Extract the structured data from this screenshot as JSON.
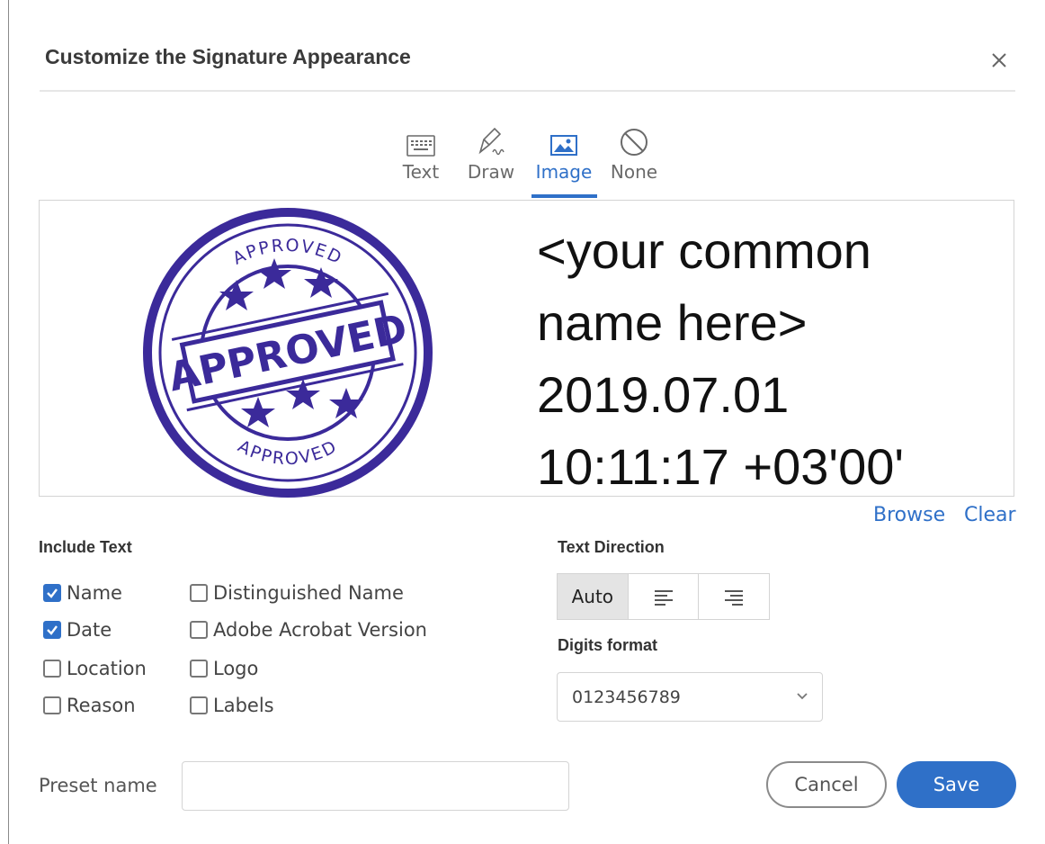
{
  "dialog": {
    "title": "Customize the Signature Appearance",
    "accent_color": "#2f70c8"
  },
  "tabs": [
    {
      "label": "Text",
      "icon": "keyboard-icon",
      "active": false
    },
    {
      "label": "Draw",
      "icon": "pen-icon",
      "active": false
    },
    {
      "label": "Image",
      "icon": "image-icon",
      "active": true
    },
    {
      "label": "None",
      "icon": "no-symbol-icon",
      "active": false
    }
  ],
  "preview": {
    "stamp_word": "APPROVED",
    "stamp_color": "#3b2a9a",
    "signature_lines": [
      "<your common",
      "name here>",
      "2019.07.01",
      "10:11:17 +03'00'"
    ]
  },
  "image_actions": {
    "browse": "Browse",
    "clear": "Clear"
  },
  "include_text": {
    "label": "Include Text",
    "options": [
      {
        "label": "Name",
        "checked": true
      },
      {
        "label": "Date",
        "checked": true
      },
      {
        "label": "Location",
        "checked": false
      },
      {
        "label": "Reason",
        "checked": false
      },
      {
        "label": "Distinguished Name",
        "checked": false
      },
      {
        "label": "Adobe Acrobat Version",
        "checked": false
      },
      {
        "label": "Logo",
        "checked": false
      },
      {
        "label": "Labels",
        "checked": false
      }
    ]
  },
  "text_direction": {
    "label": "Text Direction",
    "options": [
      {
        "label": "Auto",
        "active": true
      },
      {
        "icon": "align-left-icon",
        "active": false
      },
      {
        "icon": "align-right-icon",
        "active": false
      }
    ]
  },
  "digits_format": {
    "label": "Digits format",
    "selected": "0123456789"
  },
  "preset": {
    "label": "Preset name",
    "value": ""
  },
  "buttons": {
    "cancel": "Cancel",
    "save": "Save"
  }
}
